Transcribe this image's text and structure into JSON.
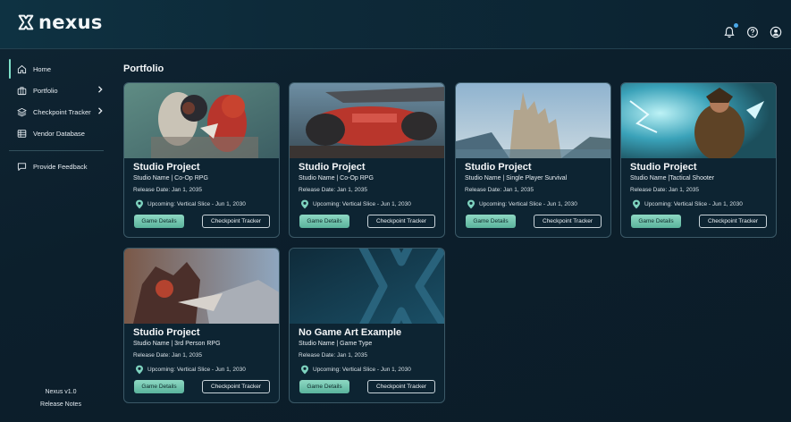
{
  "app": {
    "logo_text": "nexus"
  },
  "header": {
    "icons": [
      "bell-icon",
      "help-icon",
      "account-icon"
    ]
  },
  "sidebar": {
    "items": [
      {
        "label": "Home",
        "icon": "home-icon",
        "active": true
      },
      {
        "label": "Portfolio",
        "icon": "portfolio-icon",
        "expandable": true
      },
      {
        "label": "Checkpoint Tracker",
        "icon": "layers-icon",
        "expandable": true
      },
      {
        "label": "Vendor Database",
        "icon": "database-icon"
      },
      {
        "label": "Provide Feedback",
        "icon": "feedback-icon"
      }
    ],
    "version": "Nexus v1.0",
    "release_notes": "Release Notes"
  },
  "main": {
    "title": "Portfolio",
    "cards": [
      {
        "title": "Studio Project",
        "subtitle": "Studio Name | Co-Op RPG",
        "release": "Release Date: Jan 1, 2035",
        "upcoming": "Upcoming: Vertical Slice - Jun 1, 2030",
        "details_label": "Game Details",
        "tracker_label": "Checkpoint Tracker",
        "art": "robots"
      },
      {
        "title": "Studio Project",
        "subtitle": "Studio Name | Co-Op RPG",
        "release": "Release Date: Jan 1, 2035",
        "upcoming": "Upcoming: Vertical Slice - Jun 1, 2030",
        "details_label": "Game Details",
        "tracker_label": "Checkpoint Tracker",
        "art": "vehicle"
      },
      {
        "title": "Studio Project",
        "subtitle": "Studio Name | Single Player Survival",
        "release": "Release Date: Jan 1, 2035",
        "upcoming": "Upcoming: Vertical Slice - Jun 1, 2030",
        "details_label": "Game Details",
        "tracker_label": "Checkpoint Tracker",
        "art": "castle"
      },
      {
        "title": "Studio Project",
        "subtitle": "Studio Name |Tactical Shooter",
        "release": "Release Date: Jan 1, 2035",
        "upcoming": "Upcoming: Vertical Slice - Jun 1, 2030",
        "details_label": "Game Details",
        "tracker_label": "Checkpoint Tracker",
        "art": "wizard"
      },
      {
        "title": "Studio Project",
        "subtitle": "Studio Name | 3rd Person RPG",
        "release": "Release Date: Jan 1, 2035",
        "upcoming": "Upcoming: Vertical Slice - Jun 1, 2030",
        "details_label": "Game Details",
        "tracker_label": "Checkpoint Tracker",
        "art": "mech"
      },
      {
        "title": "No Game Art Example",
        "subtitle": "Studio Name | Game Type",
        "release": "Release Date: Jan 1, 2035",
        "upcoming": "Upcoming: Vertical Slice - Jun 1, 2030",
        "details_label": "Game Details",
        "tracker_label": "Checkpoint Tracker",
        "art": "placeholder"
      }
    ]
  },
  "colors": {
    "accent": "#7ee0c8",
    "button_green": "#6cc4ac",
    "background": "#0c1f2c",
    "card_border": "#3b5967"
  }
}
